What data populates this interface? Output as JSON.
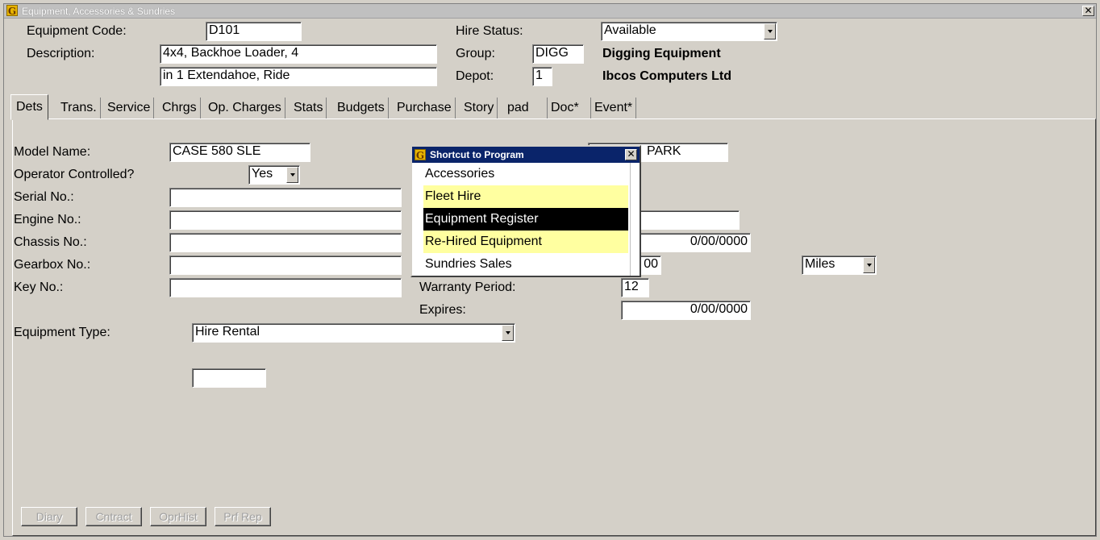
{
  "window": {
    "title": "Equipment, Accessories & Sundries",
    "icon": "G"
  },
  "header": {
    "equipment_code_label": "Equipment Code:",
    "equipment_code": "D101",
    "description_label": "Description:",
    "description_line1": "4x4, Backhoe Loader, 4",
    "description_line2": "in 1 Extendahoe, Ride",
    "hire_status_label": "Hire Status:",
    "hire_status": "Available",
    "group_label": "Group:",
    "group_code": "DIGG",
    "group_name": "Digging Equipment",
    "depot_label": "Depot:",
    "depot_code": "1",
    "depot_name": "Ibcos Computers Ltd"
  },
  "tabs": [
    {
      "label": "Dets",
      "active": true
    },
    {
      "label": "Trans."
    },
    {
      "label": "Service"
    },
    {
      "label": "Chrgs"
    },
    {
      "label": "Op. Charges"
    },
    {
      "label": "Stats"
    },
    {
      "label": "Budgets"
    },
    {
      "label": "Purchase"
    },
    {
      "label": "Story"
    },
    {
      "label": "pad"
    },
    {
      "label": "Doc*"
    },
    {
      "label": "Event*"
    }
  ],
  "details": {
    "model_name_label": "Model Name:",
    "model_name": "CASE 580 SLE",
    "operator_controlled_label": "Operator Controlled?",
    "operator_controlled": "Yes",
    "serial_no_label": "Serial No.:",
    "serial_no": "",
    "engine_no_label": "Engine No.:",
    "engine_no": "",
    "chassis_no_label": "Chassis No.:",
    "chassis_no": "",
    "gearbox_no_label": "Gearbox No.:",
    "gearbox_no": "",
    "key_no_label": "Key No.:",
    "key_no": "",
    "equipment_type_label": "Equipment Type:",
    "equipment_type": "Hire Rental",
    "extra_field": "",
    "right_top_field": "PARK",
    "right_field_2": "",
    "right_date_1": "0/00/0000",
    "right_meter": "00",
    "meter_unit": "Miles",
    "warranty_period_label": "Warranty Period:",
    "warranty_period": "12",
    "expires_label": "Expires:",
    "expires": "0/00/0000"
  },
  "buttons": {
    "diary": "Diary",
    "contract": "Cntract",
    "oprhist": "OprHist",
    "prf_rep": "Prf Rep"
  },
  "popup": {
    "title": "Shortcut to Program",
    "icon": "G",
    "items": [
      {
        "label": "Accessories",
        "style": "normal"
      },
      {
        "label": "Fleet Hire",
        "style": "yellow"
      },
      {
        "label": "Equipment Register",
        "style": "selected"
      },
      {
        "label": "Re-Hired Equipment",
        "style": "yellow"
      },
      {
        "label": "Sundries Sales",
        "style": "normal"
      }
    ]
  }
}
